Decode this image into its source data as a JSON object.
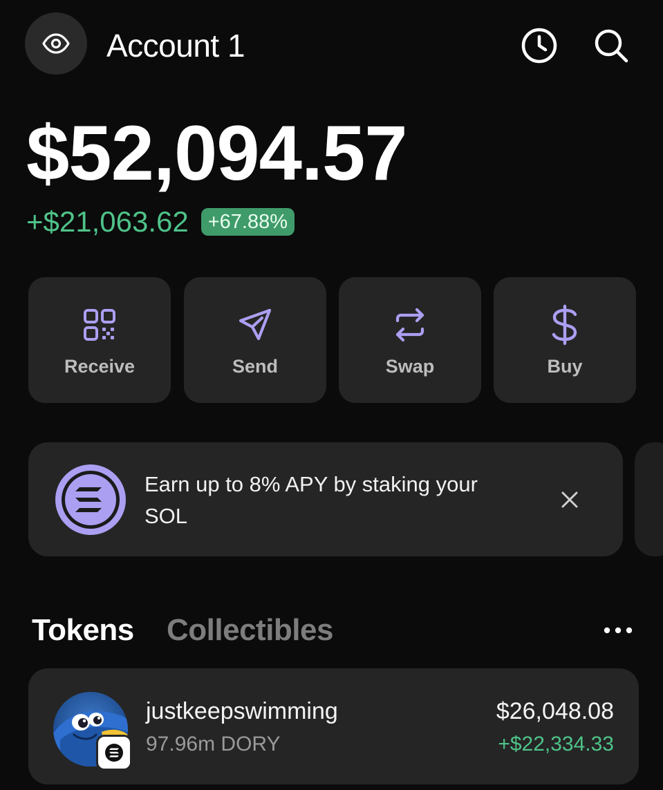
{
  "header": {
    "account_name": "Account 1",
    "icons": {
      "visibility": "eye-icon",
      "history": "clock-icon",
      "search": "search-icon"
    }
  },
  "balance": {
    "total": "$52,094.57",
    "change_amount": "+$21,063.62",
    "change_percent": "+67.88%"
  },
  "actions": [
    {
      "label": "Receive",
      "icon": "qr-code-icon"
    },
    {
      "label": "Send",
      "icon": "send-icon"
    },
    {
      "label": "Swap",
      "icon": "swap-icon"
    },
    {
      "label": "Buy",
      "icon": "dollar-icon"
    }
  ],
  "promo": {
    "text": "Earn up to 8% APY by staking your SOL",
    "icon": "solana-icon"
  },
  "tabs": {
    "tokens": "Tokens",
    "collectibles": "Collectibles",
    "active": "Tokens"
  },
  "tokens": [
    {
      "name": "justkeepswimming",
      "amount": "97.96m DORY",
      "value": "$26,048.08",
      "change": "+$22,334.33"
    }
  ],
  "colors": {
    "background": "#0b0b0b",
    "card": "#252525",
    "accent": "#ab9ff2",
    "positive": "#4fc38a",
    "badge": "#3f9b6a"
  }
}
